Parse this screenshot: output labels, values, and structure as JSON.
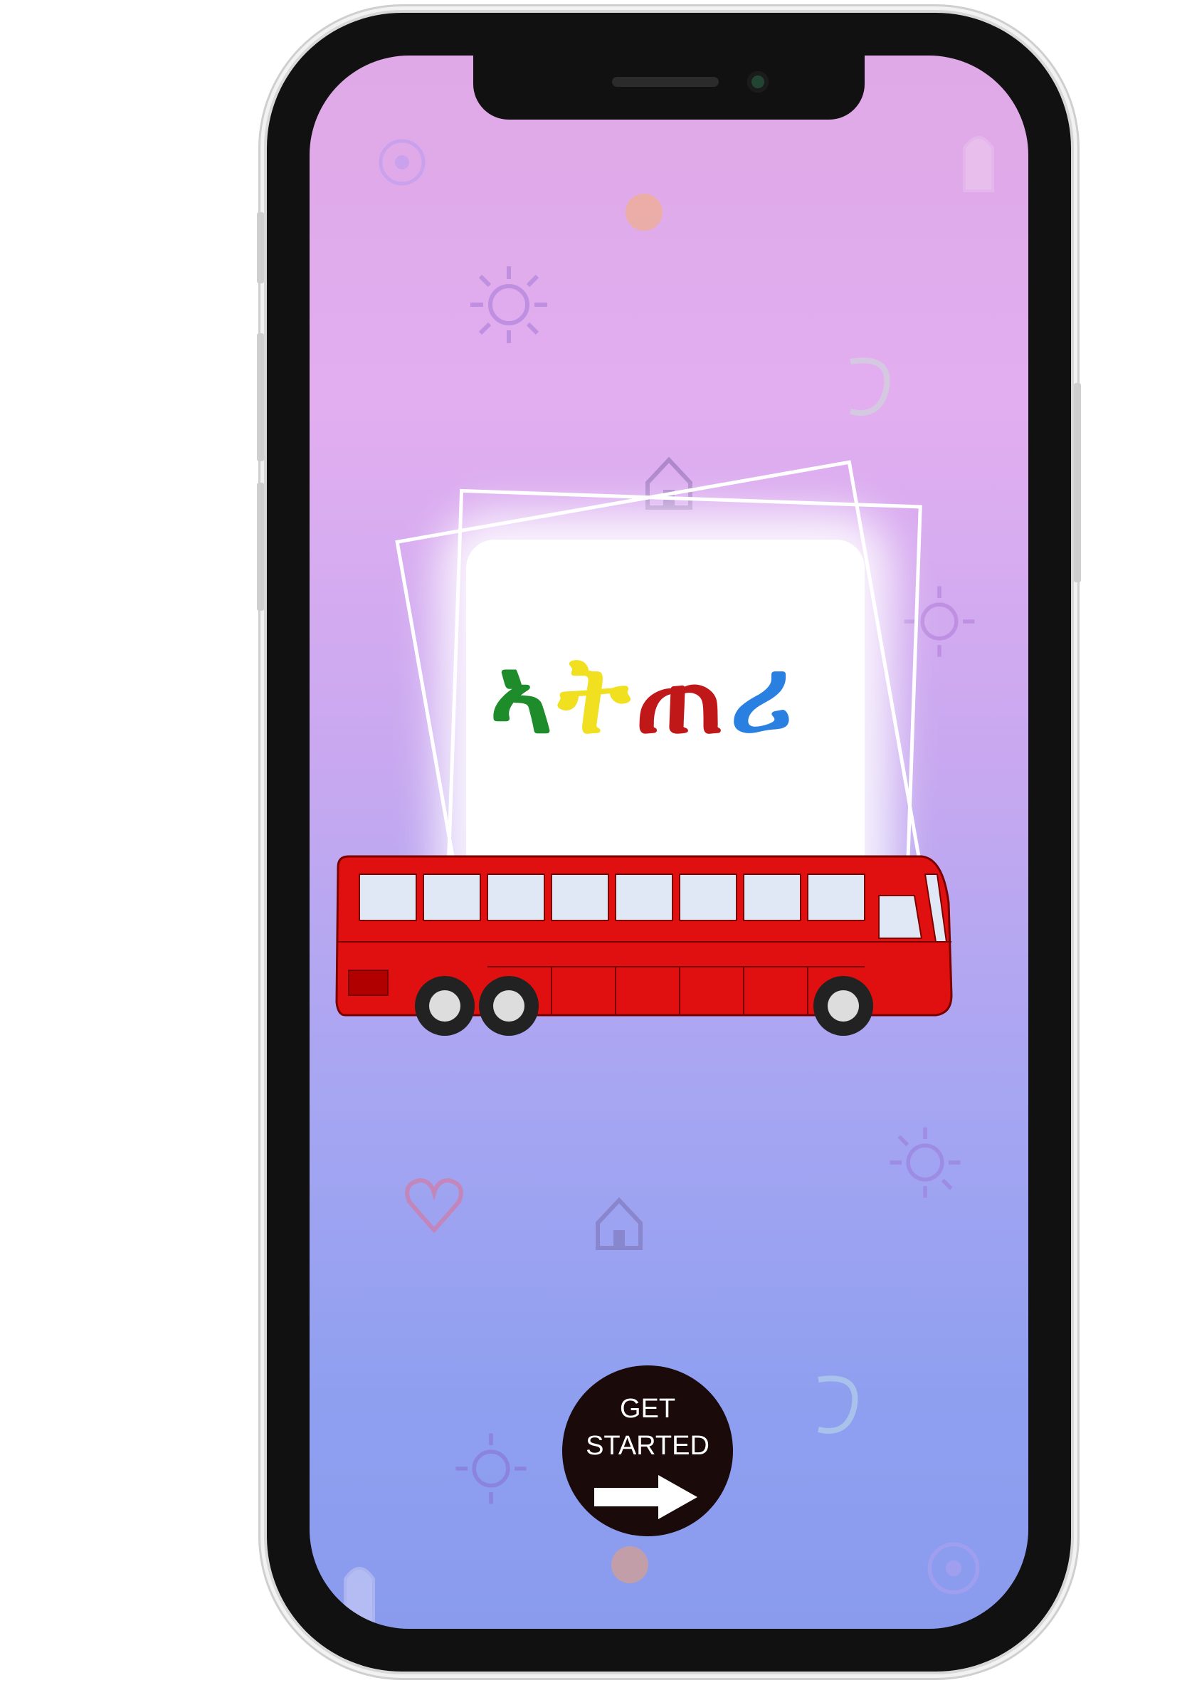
{
  "logo": {
    "text": "ኣትጠሪ"
  },
  "get_started": {
    "line1": "GET",
    "line2": "STARTED"
  },
  "icons": [
    "sun-icon",
    "house-icon",
    "heart-icon",
    "flower-icon",
    "ghost-icon",
    "swirl-icon",
    "dot-icon"
  ],
  "colors": {
    "bus": "#e01010",
    "button": "#1a0a0a",
    "gradient_top": "#dfa8e6",
    "gradient_bottom": "#8a9bee"
  }
}
